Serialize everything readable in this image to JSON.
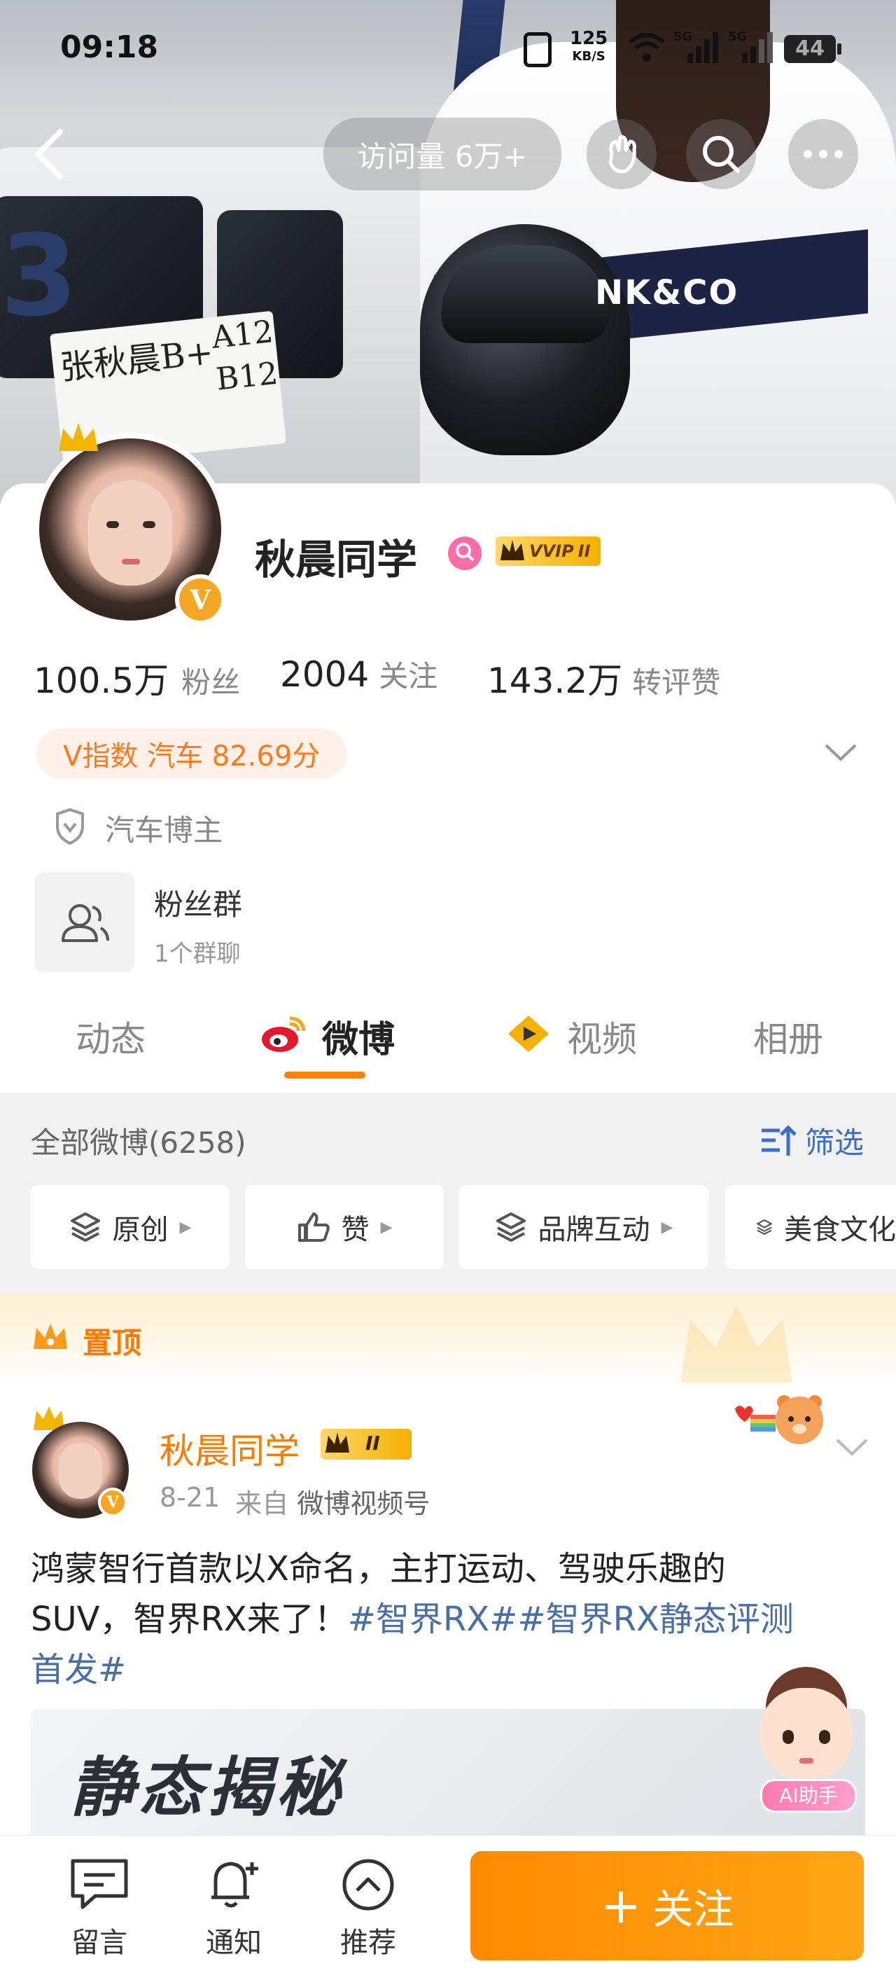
{
  "status_bar": {
    "time": "09:18",
    "speed_value": "125",
    "speed_unit": "KB/S",
    "net1": "5G",
    "net2": "5G",
    "battery": "44"
  },
  "top_nav": {
    "visits": "访问量 6万+"
  },
  "profile": {
    "name": "秋晨同学",
    "vip_label": "VVIP",
    "vip_level": "II",
    "fans_count": "100.5万",
    "fans_label": "粉丝",
    "following_count": "2004",
    "following_label": "关注",
    "likes_count": "143.2万",
    "likes_label": "转评赞",
    "v_index": "V指数 汽车 82.69分",
    "tag": "汽车博主",
    "fan_group": {
      "title": "粉丝群",
      "subtitle": "1个群聊"
    }
  },
  "cover": {
    "plate_line1": "张秋晨B+",
    "plate_line2": "A12",
    "plate_line3": "B12",
    "brand": "NK&CO",
    "number": "3"
  },
  "tabs": [
    {
      "label": "动态"
    },
    {
      "label": "微博"
    },
    {
      "label": "视频"
    },
    {
      "label": "相册"
    }
  ],
  "feed_header": {
    "all_posts": "全部微博(6258)",
    "filter": "筛选"
  },
  "filter_chips": [
    {
      "label": "原创"
    },
    {
      "label": "赞"
    },
    {
      "label": "品牌互动"
    },
    {
      "label": "美食文化"
    }
  ],
  "pinned": {
    "label": "置顶"
  },
  "post": {
    "author": "秋晨同学",
    "date": "8-21",
    "source_prefix": "来自",
    "source": "微博视频号",
    "text_line1": "鸿蒙智行首款以X命名，主打运动、驾驶乐趣的",
    "text_line2_plain": "SUV，智界RX来了！",
    "text_line2_tag": "#智界RX##智界RX静态评测",
    "text_line3_tag": "首发#",
    "thumb_title": "静态揭秘"
  },
  "ai_assistant": {
    "label": "AI助手"
  },
  "bottom_bar": {
    "message": "留言",
    "notify": "通知",
    "recommend": "推荐",
    "follow": "关注"
  },
  "colors": {
    "accent": "#ff8200",
    "link": "#4a6fa5",
    "vip_gold": "#f5b000",
    "female_pink": "#ff6ca8"
  }
}
